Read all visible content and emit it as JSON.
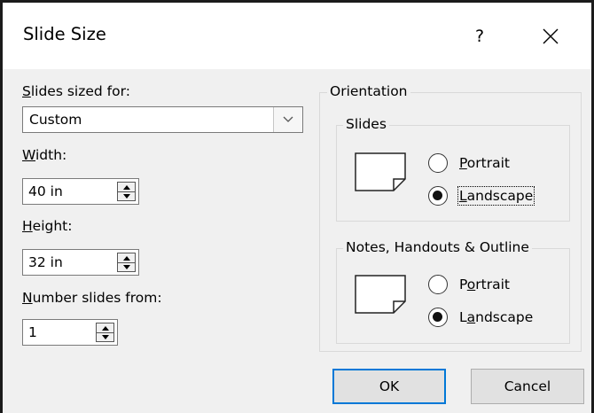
{
  "dialog": {
    "title": "Slide Size",
    "help_label": "?",
    "close_label": "close"
  },
  "left": {
    "sized_for_label": "Slides sized for:",
    "sized_for_underline": "S",
    "sized_for_rest": "lides sized for:",
    "sized_for_value": "Custom",
    "width_label_underline": "W",
    "width_label_rest": "idth:",
    "width_value": "40 in",
    "height_label_underline": "H",
    "height_label_rest": "eight:",
    "height_value": "32 in",
    "number_label_underline": "N",
    "number_label_rest": "umber slides from:",
    "number_value": "1"
  },
  "orientation": {
    "title": "Orientation",
    "slides": {
      "title": "Slides",
      "portrait_underline": "P",
      "portrait_rest": "ortrait",
      "landscape_underline": "L",
      "landscape_rest": "andscape",
      "selected": "Landscape"
    },
    "notes": {
      "title": "Notes, Handouts & Outline",
      "portrait_pre": "P",
      "portrait_underline": "o",
      "portrait_rest": "rtrait",
      "landscape_pre": "L",
      "landscape_underline": "a",
      "landscape_rest": "ndscape",
      "selected": "Landscape"
    }
  },
  "buttons": {
    "ok": "OK",
    "cancel": "Cancel"
  },
  "colors": {
    "default_button_border": "#0078d7",
    "dialog_background": "#f0f0f0"
  }
}
